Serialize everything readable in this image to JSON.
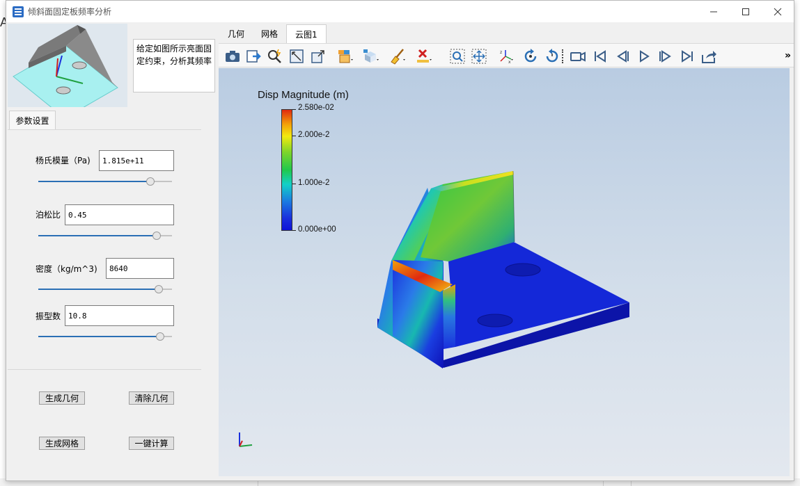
{
  "window": {
    "title": "倾斜面固定板频率分析",
    "controls": [
      "minimize",
      "maximize",
      "close"
    ]
  },
  "background": {
    "letter": "A"
  },
  "left_panel": {
    "description": "给定如图所示亮面固定约束，分析其频率",
    "description_lines": [
      "给定如图所示亮面固",
      "定约束，分析其频率"
    ],
    "param_tab": "参数设置",
    "fields": [
      {
        "label": "杨氏模量（Pa)",
        "value": "1.815e+11",
        "slider_fraction": 0.84
      },
      {
        "label": "泊松比",
        "value": "0.45",
        "slider_fraction": 0.88
      },
      {
        "label": "密度（kg/m^3)",
        "value": "8640",
        "slider_fraction": 0.9
      },
      {
        "label": "振型数",
        "value": "10.8",
        "slider_fraction": 0.91
      }
    ],
    "buttons": {
      "gen_geometry": "生成几何",
      "clear_geometry": "清除几何",
      "gen_mesh": "生成网格",
      "compute": "一键计算"
    }
  },
  "tabs": [
    {
      "label": "几何",
      "active": false
    },
    {
      "label": "网格",
      "active": false
    },
    {
      "label": "云图1",
      "active": true
    }
  ],
  "toolbar": {
    "icons": [
      "camera-icon",
      "export-icon",
      "zoom-select-icon",
      "fit-view-icon",
      "scale-view-icon",
      "display-mode-icon",
      "view-cube-icon",
      "clean-brush-icon",
      "delete-icon",
      "zoom-box-icon",
      "pan-icon",
      "axis-icon",
      "rotate-cw-icon",
      "rotate-ccw-icon",
      "video-icon",
      "first-frame-icon",
      "prev-frame-icon",
      "play-icon",
      "next-frame-icon",
      "last-frame-icon",
      "share-icon"
    ],
    "more": "»"
  },
  "viewport": {
    "legend": {
      "title": "Disp Magnitude (m)",
      "labels": [
        "2.580e-02",
        "2.000e-2",
        "1.000e-2",
        "0.000e+00"
      ]
    },
    "colors": {
      "max": "#e02a10",
      "min": "#0e12d8"
    }
  }
}
